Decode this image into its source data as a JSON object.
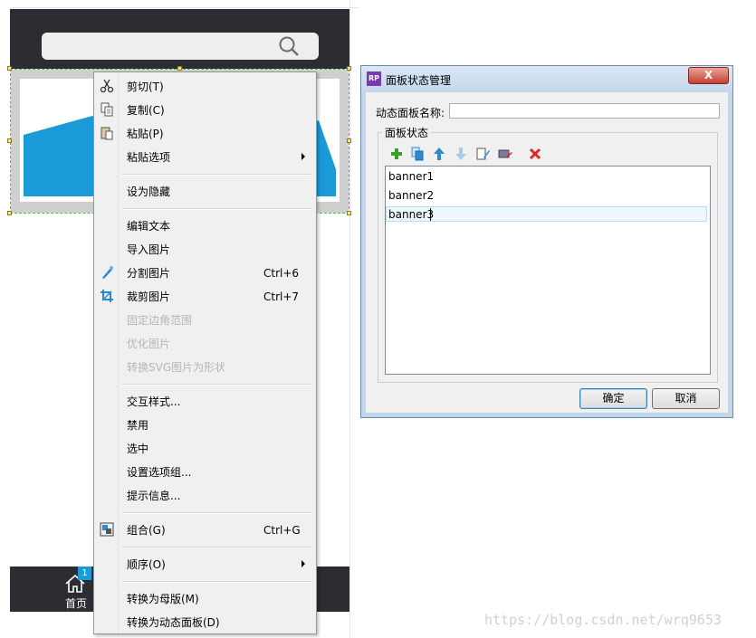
{
  "canvas": {
    "home_label": "首页",
    "badge_count": "1"
  },
  "context_menu": {
    "items": [
      {
        "label": "剪切(T)",
        "icon": "scissors-icon",
        "enabled": true
      },
      {
        "label": "复制(C)",
        "icon": "copy-icon",
        "enabled": true
      },
      {
        "label": "粘贴(P)",
        "icon": "paste-icon",
        "enabled": true
      },
      {
        "label": "粘贴选项",
        "submenu": true,
        "enabled": true
      },
      {
        "label": "设为隐藏",
        "enabled": true
      },
      {
        "label": "编辑文本",
        "enabled": true
      },
      {
        "label": "导入图片",
        "enabled": true
      },
      {
        "label": "分割图片",
        "shortcut": "Ctrl+6",
        "icon": "slice-icon",
        "enabled": true
      },
      {
        "label": "裁剪图片",
        "shortcut": "Ctrl+7",
        "icon": "crop-icon",
        "enabled": true
      },
      {
        "label": "固定边角范围",
        "enabled": false
      },
      {
        "label": "优化图片",
        "enabled": false
      },
      {
        "label": "转换SVG图片为形状",
        "enabled": false
      },
      {
        "label": "交互样式...",
        "enabled": true
      },
      {
        "label": "禁用",
        "enabled": true
      },
      {
        "label": "选中",
        "enabled": true
      },
      {
        "label": "设置选项组...",
        "enabled": true
      },
      {
        "label": "提示信息...",
        "enabled": true
      },
      {
        "label": "组合(G)",
        "shortcut": "Ctrl+G",
        "icon": "group-icon",
        "enabled": true
      },
      {
        "label": "顺序(O)",
        "submenu": true,
        "enabled": true
      },
      {
        "label": "转换为母版(M)",
        "enabled": true
      },
      {
        "label": "转换为动态面板(D)",
        "enabled": true
      }
    ]
  },
  "dialog": {
    "title": "面板状态管理",
    "app_icon_text": "RP",
    "close_label": "X",
    "name_label": "动态面板名称:",
    "name_value": "",
    "group_title": "面板状态",
    "states": [
      "banner1",
      "banner2",
      "banner3"
    ],
    "editing_index": 2,
    "ok_label": "确定",
    "cancel_label": "取消"
  },
  "watermark": "https://blog.csdn.net/wrq9653",
  "colors": {
    "phone_dark": "#2b2d33",
    "banner_blue": "#1a9ad6",
    "selection_green": "#39c93a",
    "delete_red": "#e0281e",
    "add_green": "#3aa02a",
    "arrow_blue": "#2a8ad0"
  }
}
